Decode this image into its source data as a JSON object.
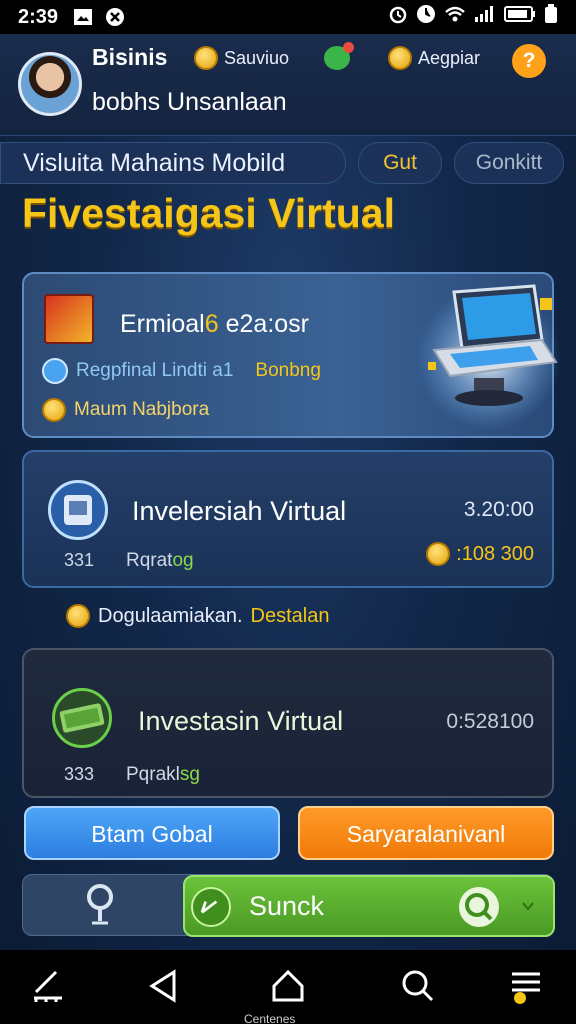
{
  "status": {
    "time": "2:39"
  },
  "header": {
    "user_name": "Bisinis",
    "user_sub": "bobhs Unsanlaan",
    "chip1": "Sauviuo",
    "chip2": "Aegpiar",
    "help": "?"
  },
  "title_row": {
    "app_title": "Visluita Mahains Mobild",
    "btn_gut": "Gut",
    "btn_gonkitt": "Gonkitt"
  },
  "page_title": "Fivestaigasi Virtual",
  "featured": {
    "title_main": "Ermioal",
    "title_accent": "6",
    "title_rest": " e2a:osr",
    "line1_a": "Regpfinal Lindti a1",
    "line1_b": "Bonbng",
    "line2": "Maum Nabjbora"
  },
  "investment1": {
    "title": "Invelersiah Virtual",
    "amount": "3.20:00",
    "count": "331",
    "status_a": "Rqrat",
    "status_b": "og",
    "bonus": ":108 300"
  },
  "notice": {
    "text_a": "Dogulaamiakan.",
    "text_b": "Destalan"
  },
  "investment2": {
    "title": "Investasin Virtual",
    "amount": "0:528100",
    "count": "333",
    "status_a": "Pqrakl",
    "status_b": "sg"
  },
  "buttons": {
    "blue": "Btam Gobal",
    "orange": "Saryaralanivanl"
  },
  "search": {
    "label": "Sunck"
  },
  "navbar": {
    "label": "Centenes"
  },
  "colors": {
    "accent_yellow": "#f5c518",
    "accent_green": "#6cc23a",
    "accent_orange": "#f07a07",
    "accent_blue": "#2c7de0"
  },
  "icons": [
    "gallery-icon",
    "close-icon",
    "alarm-icon",
    "wifi-icon",
    "signal-icon",
    "battery-icon",
    "coin-icon",
    "help-icon",
    "laptop-icon",
    "pin-icon",
    "magnifier-icon",
    "home-icon",
    "back-icon",
    "menu-icon"
  ]
}
